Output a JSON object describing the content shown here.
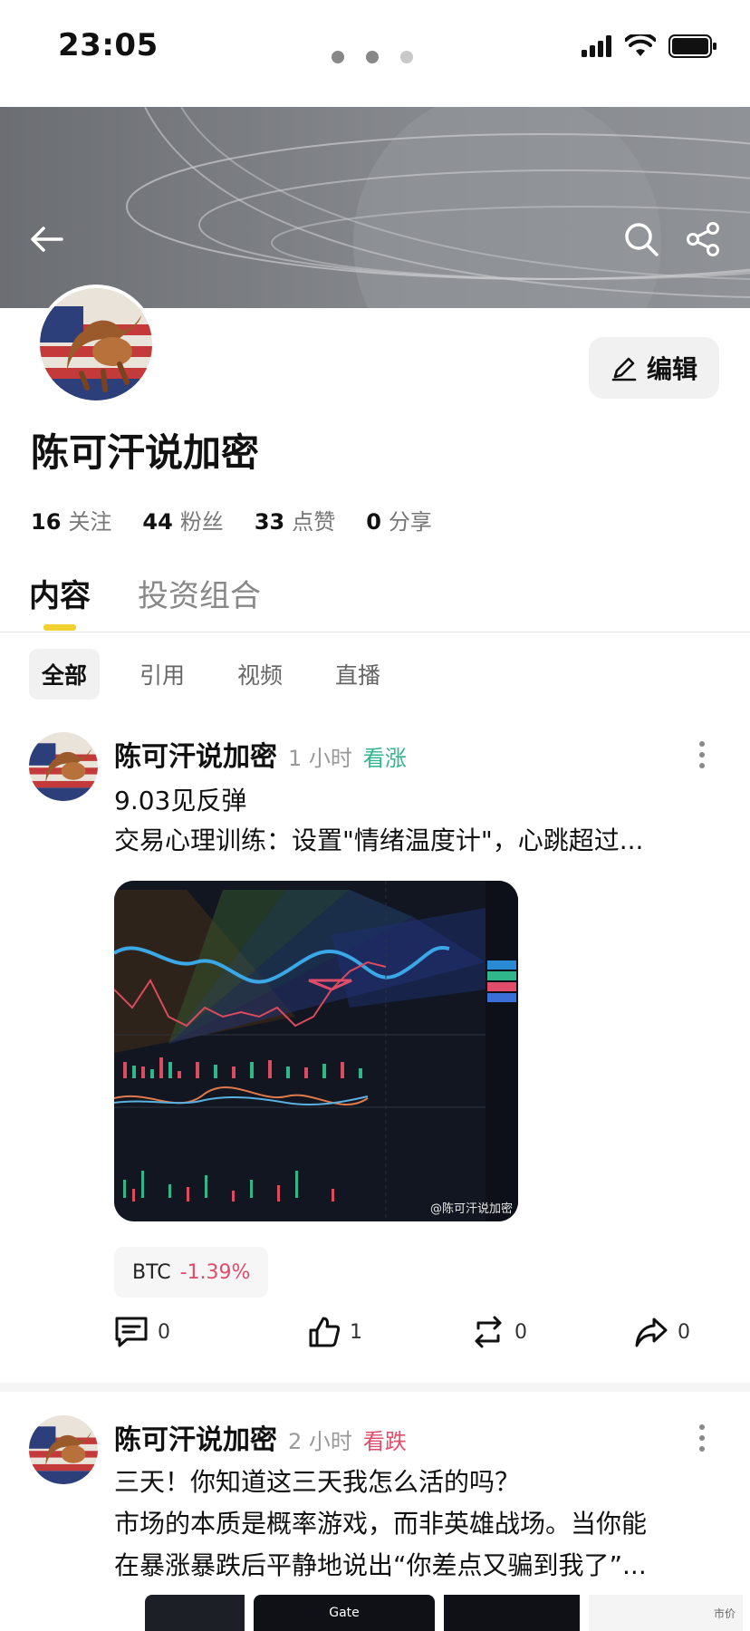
{
  "status_bar": {
    "time": "23:05"
  },
  "profile": {
    "name": "陈可汗说加密",
    "edit_label": "编辑",
    "stats": [
      {
        "count": "16",
        "label": "关注"
      },
      {
        "count": "44",
        "label": "粉丝"
      },
      {
        "count": "33",
        "label": "点赞"
      },
      {
        "count": "0",
        "label": "分享"
      }
    ]
  },
  "tabs": [
    {
      "label": "内容",
      "active": true
    },
    {
      "label": "投资组合",
      "active": false
    }
  ],
  "filters": [
    {
      "label": "全部",
      "active": true
    },
    {
      "label": "引用",
      "active": false
    },
    {
      "label": "视频",
      "active": false
    },
    {
      "label": "直播",
      "active": false
    }
  ],
  "posts": [
    {
      "author": "陈可汗说加密",
      "time": "1 小时",
      "sentiment": "看涨",
      "sentiment_color": "#2fb68a",
      "lines": [
        "9.03见反弹",
        "交易心理训练：设置\"情绪温度计\"，心跳超过..."
      ],
      "image_watermark": "@陈可汗说加密",
      "coin": {
        "symbol": "BTC",
        "change": "-1.39%",
        "change_color": "#e04d6a"
      },
      "actions": {
        "comments": "0",
        "likes": "1",
        "reposts": "0",
        "shares": "0"
      }
    },
    {
      "author": "陈可汗说加密",
      "time": "2 小时",
      "sentiment": "看跌",
      "sentiment_color": "#e04d6a",
      "lines": [
        "三天！你知道这三天我怎么活的吗？",
        "市场的本质是概率游戏，而非英雄战场。当你能",
        "在暴涨暴跌后平静地说出“你差点又骗到我了”..."
      ],
      "image_labels": [
        "Gate",
        "市价"
      ]
    }
  ],
  "colors": {
    "accent": "#f0d130",
    "up": "#2fb68a",
    "down": "#e04d6a"
  }
}
